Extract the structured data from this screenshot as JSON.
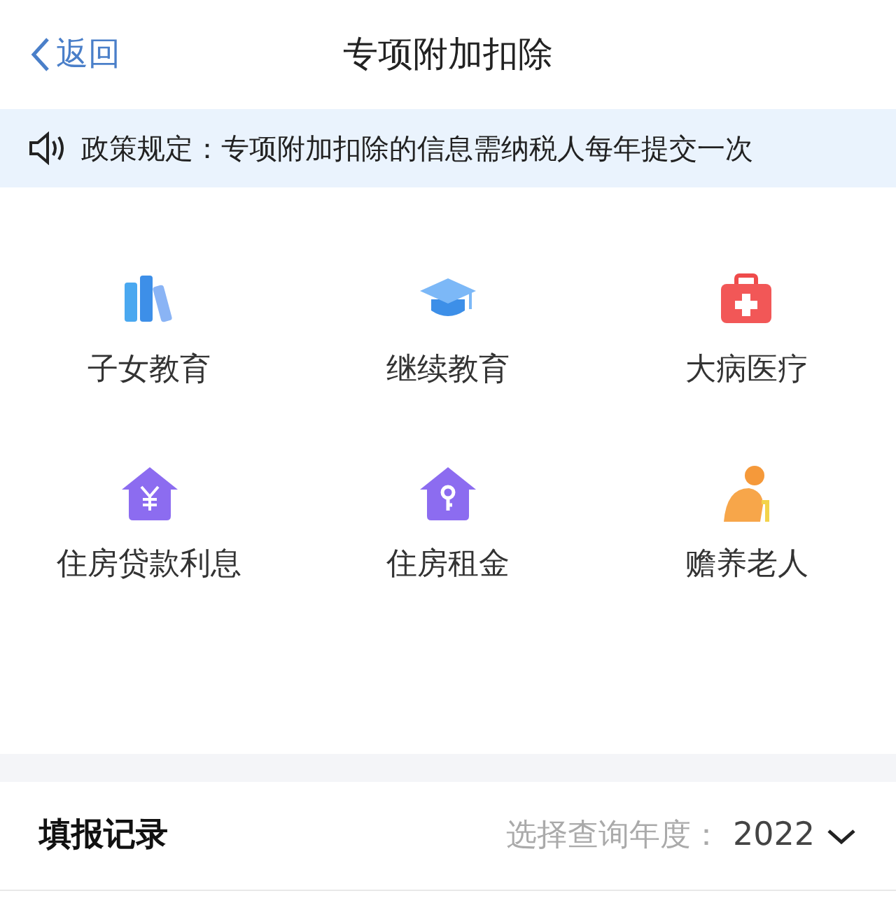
{
  "nav": {
    "back": "返回",
    "title": "专项附加扣除"
  },
  "notice": {
    "text": "政策规定：专项附加扣除的信息需纳税人每年提交一次"
  },
  "categories": [
    {
      "label": "子女教育",
      "kind": "books"
    },
    {
      "label": "继续教育",
      "kind": "cap"
    },
    {
      "label": "大病医疗",
      "kind": "medkit"
    },
    {
      "label": "住房贷款利息",
      "kind": "house-yen"
    },
    {
      "label": "住房租金",
      "kind": "house-key"
    },
    {
      "label": "赡养老人",
      "kind": "elder"
    }
  ],
  "records": {
    "title": "填报记录",
    "year_label": "选择查询年度：",
    "year": "2022"
  }
}
